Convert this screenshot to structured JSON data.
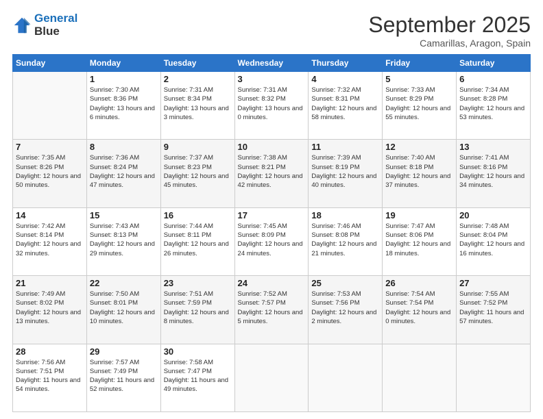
{
  "logo": {
    "line1": "General",
    "line2": "Blue"
  },
  "title": "September 2025",
  "location": "Camarillas, Aragon, Spain",
  "days_header": [
    "Sunday",
    "Monday",
    "Tuesday",
    "Wednesday",
    "Thursday",
    "Friday",
    "Saturday"
  ],
  "weeks": [
    [
      {
        "day": "",
        "sunrise": "",
        "sunset": "",
        "daylight": ""
      },
      {
        "day": "1",
        "sunrise": "Sunrise: 7:30 AM",
        "sunset": "Sunset: 8:36 PM",
        "daylight": "Daylight: 13 hours and 6 minutes."
      },
      {
        "day": "2",
        "sunrise": "Sunrise: 7:31 AM",
        "sunset": "Sunset: 8:34 PM",
        "daylight": "Daylight: 13 hours and 3 minutes."
      },
      {
        "day": "3",
        "sunrise": "Sunrise: 7:31 AM",
        "sunset": "Sunset: 8:32 PM",
        "daylight": "Daylight: 13 hours and 0 minutes."
      },
      {
        "day": "4",
        "sunrise": "Sunrise: 7:32 AM",
        "sunset": "Sunset: 8:31 PM",
        "daylight": "Daylight: 12 hours and 58 minutes."
      },
      {
        "day": "5",
        "sunrise": "Sunrise: 7:33 AM",
        "sunset": "Sunset: 8:29 PM",
        "daylight": "Daylight: 12 hours and 55 minutes."
      },
      {
        "day": "6",
        "sunrise": "Sunrise: 7:34 AM",
        "sunset": "Sunset: 8:28 PM",
        "daylight": "Daylight: 12 hours and 53 minutes."
      }
    ],
    [
      {
        "day": "7",
        "sunrise": "Sunrise: 7:35 AM",
        "sunset": "Sunset: 8:26 PM",
        "daylight": "Daylight: 12 hours and 50 minutes."
      },
      {
        "day": "8",
        "sunrise": "Sunrise: 7:36 AM",
        "sunset": "Sunset: 8:24 PM",
        "daylight": "Daylight: 12 hours and 47 minutes."
      },
      {
        "day": "9",
        "sunrise": "Sunrise: 7:37 AM",
        "sunset": "Sunset: 8:23 PM",
        "daylight": "Daylight: 12 hours and 45 minutes."
      },
      {
        "day": "10",
        "sunrise": "Sunrise: 7:38 AM",
        "sunset": "Sunset: 8:21 PM",
        "daylight": "Daylight: 12 hours and 42 minutes."
      },
      {
        "day": "11",
        "sunrise": "Sunrise: 7:39 AM",
        "sunset": "Sunset: 8:19 PM",
        "daylight": "Daylight: 12 hours and 40 minutes."
      },
      {
        "day": "12",
        "sunrise": "Sunrise: 7:40 AM",
        "sunset": "Sunset: 8:18 PM",
        "daylight": "Daylight: 12 hours and 37 minutes."
      },
      {
        "day": "13",
        "sunrise": "Sunrise: 7:41 AM",
        "sunset": "Sunset: 8:16 PM",
        "daylight": "Daylight: 12 hours and 34 minutes."
      }
    ],
    [
      {
        "day": "14",
        "sunrise": "Sunrise: 7:42 AM",
        "sunset": "Sunset: 8:14 PM",
        "daylight": "Daylight: 12 hours and 32 minutes."
      },
      {
        "day": "15",
        "sunrise": "Sunrise: 7:43 AM",
        "sunset": "Sunset: 8:13 PM",
        "daylight": "Daylight: 12 hours and 29 minutes."
      },
      {
        "day": "16",
        "sunrise": "Sunrise: 7:44 AM",
        "sunset": "Sunset: 8:11 PM",
        "daylight": "Daylight: 12 hours and 26 minutes."
      },
      {
        "day": "17",
        "sunrise": "Sunrise: 7:45 AM",
        "sunset": "Sunset: 8:09 PM",
        "daylight": "Daylight: 12 hours and 24 minutes."
      },
      {
        "day": "18",
        "sunrise": "Sunrise: 7:46 AM",
        "sunset": "Sunset: 8:08 PM",
        "daylight": "Daylight: 12 hours and 21 minutes."
      },
      {
        "day": "19",
        "sunrise": "Sunrise: 7:47 AM",
        "sunset": "Sunset: 8:06 PM",
        "daylight": "Daylight: 12 hours and 18 minutes."
      },
      {
        "day": "20",
        "sunrise": "Sunrise: 7:48 AM",
        "sunset": "Sunset: 8:04 PM",
        "daylight": "Daylight: 12 hours and 16 minutes."
      }
    ],
    [
      {
        "day": "21",
        "sunrise": "Sunrise: 7:49 AM",
        "sunset": "Sunset: 8:02 PM",
        "daylight": "Daylight: 12 hours and 13 minutes."
      },
      {
        "day": "22",
        "sunrise": "Sunrise: 7:50 AM",
        "sunset": "Sunset: 8:01 PM",
        "daylight": "Daylight: 12 hours and 10 minutes."
      },
      {
        "day": "23",
        "sunrise": "Sunrise: 7:51 AM",
        "sunset": "Sunset: 7:59 PM",
        "daylight": "Daylight: 12 hours and 8 minutes."
      },
      {
        "day": "24",
        "sunrise": "Sunrise: 7:52 AM",
        "sunset": "Sunset: 7:57 PM",
        "daylight": "Daylight: 12 hours and 5 minutes."
      },
      {
        "day": "25",
        "sunrise": "Sunrise: 7:53 AM",
        "sunset": "Sunset: 7:56 PM",
        "daylight": "Daylight: 12 hours and 2 minutes."
      },
      {
        "day": "26",
        "sunrise": "Sunrise: 7:54 AM",
        "sunset": "Sunset: 7:54 PM",
        "daylight": "Daylight: 12 hours and 0 minutes."
      },
      {
        "day": "27",
        "sunrise": "Sunrise: 7:55 AM",
        "sunset": "Sunset: 7:52 PM",
        "daylight": "Daylight: 11 hours and 57 minutes."
      }
    ],
    [
      {
        "day": "28",
        "sunrise": "Sunrise: 7:56 AM",
        "sunset": "Sunset: 7:51 PM",
        "daylight": "Daylight: 11 hours and 54 minutes."
      },
      {
        "day": "29",
        "sunrise": "Sunrise: 7:57 AM",
        "sunset": "Sunset: 7:49 PM",
        "daylight": "Daylight: 11 hours and 52 minutes."
      },
      {
        "day": "30",
        "sunrise": "Sunrise: 7:58 AM",
        "sunset": "Sunset: 7:47 PM",
        "daylight": "Daylight: 11 hours and 49 minutes."
      },
      {
        "day": "",
        "sunrise": "",
        "sunset": "",
        "daylight": ""
      },
      {
        "day": "",
        "sunrise": "",
        "sunset": "",
        "daylight": ""
      },
      {
        "day": "",
        "sunrise": "",
        "sunset": "",
        "daylight": ""
      },
      {
        "day": "",
        "sunrise": "",
        "sunset": "",
        "daylight": ""
      }
    ]
  ]
}
